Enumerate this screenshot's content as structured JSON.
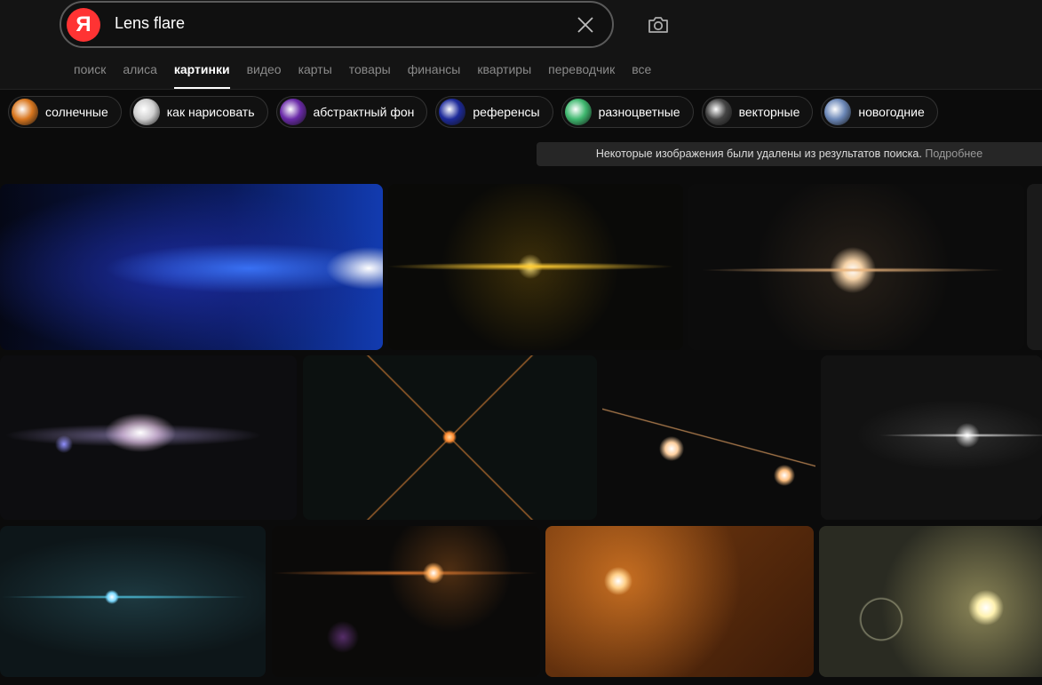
{
  "search": {
    "logo": "Я",
    "query": "Lens flare"
  },
  "icons": {
    "clear": "close-icon",
    "camera": "camera-icon"
  },
  "tabs": [
    {
      "label": "поиск",
      "active": false
    },
    {
      "label": "алиса",
      "active": false
    },
    {
      "label": "картинки",
      "active": true
    },
    {
      "label": "видео",
      "active": false
    },
    {
      "label": "карты",
      "active": false
    },
    {
      "label": "товары",
      "active": false
    },
    {
      "label": "финансы",
      "active": false
    },
    {
      "label": "квартиры",
      "active": false
    },
    {
      "label": "переводчик",
      "active": false
    },
    {
      "label": "все",
      "active": false
    }
  ],
  "chips": [
    {
      "label": "солнечные",
      "color": "#d9771f"
    },
    {
      "label": "как нарисовать",
      "color": "#cfcfcf"
    },
    {
      "label": "абстрактный фон",
      "color": "#6a2aa8"
    },
    {
      "label": "референсы",
      "color": "#1d2a9a"
    },
    {
      "label": "разноцветные",
      "color": "#3fb86f"
    },
    {
      "label": "векторные",
      "color": "#444444"
    },
    {
      "label": "новогодние",
      "color": "#6c88b8"
    }
  ],
  "notice": {
    "text": "Некоторые изображения были удалены из результатов поиска.",
    "link": "Подробнее"
  },
  "colors": {
    "background": "#0b0b0b",
    "header": "#141414",
    "logo": "#ff3333",
    "notice": "#262626"
  }
}
